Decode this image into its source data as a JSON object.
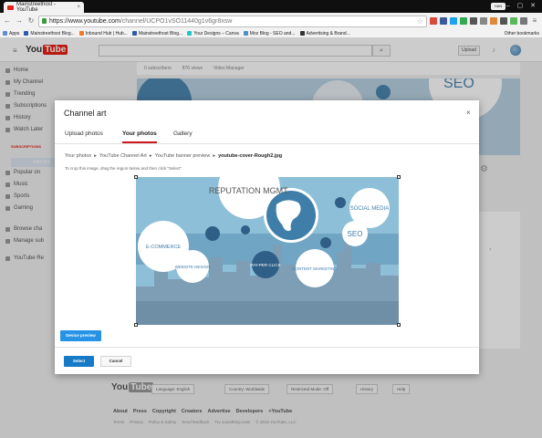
{
  "browser": {
    "tab_title": "Mainstreethost - YouTube",
    "tab_close": "×",
    "window_user": "HAN",
    "window_controls": "– ▢ ✕",
    "url_host": "https://www.youtube.com",
    "url_path": "/channel/UCPO1vSO11440g1v6gr8xsw",
    "bookmarks": [
      {
        "label": "Apps",
        "color": "#5f8dd3"
      },
      {
        "label": "Mainstreethost Blog...",
        "color": "#2d5aa8"
      },
      {
        "label": "Inbound Hub | Hub...",
        "color": "#f57722"
      },
      {
        "label": "Mainstreethost Blog...",
        "color": "#2d5aa8"
      },
      {
        "label": "Your Designs – Canva",
        "color": "#20c4cb"
      },
      {
        "label": "Moz Blog - SEO and...",
        "color": "#4a90c2"
      },
      {
        "label": "Advertising & Brand...",
        "color": "#333333"
      }
    ],
    "other_bookmarks": "Other bookmarks",
    "extensions": [
      "#d84a3a",
      "#3b5998",
      "#1da1f2",
      "#34a853",
      "#555555",
      "#888888",
      "#e0883a",
      "#555555",
      "#5cb85c",
      "#777777"
    ]
  },
  "youtube": {
    "logo_you": "You",
    "logo_tube": "Tube",
    "upload": "Upload",
    "sidebar": {
      "items": [
        "Home",
        "My Channel",
        "Trending",
        "Subscriptions",
        "History",
        "Watch Later"
      ],
      "subscriptions_heading": "SUBSCRIPTIONS",
      "add_channels": "Add cha",
      "subscriptions": [
        "Popular on",
        "Music",
        "Sports",
        "Gaming"
      ],
      "bottom_items": [
        "Browse cha",
        "Manage sub",
        "YouTube Re"
      ]
    },
    "channel_stats": {
      "subscribers": "0 subscribers",
      "views": "876 views",
      "video_manager": "Video Manager"
    },
    "footer": {
      "language": "Language: English",
      "country": "Country: Worldwide",
      "restricted": "Restricted Mode: Off",
      "history": "History",
      "help": "Help",
      "links": [
        "About",
        "Press",
        "Copyright",
        "Creators",
        "Advertise",
        "Developers",
        "+YouTube"
      ],
      "links2": [
        "Terms",
        "Privacy",
        "Policy & Safety",
        "Send feedback",
        "Try something new!",
        "© 2016 YouTube, LLC"
      ]
    }
  },
  "modal": {
    "title": "Channel art",
    "close": "×",
    "tabs": [
      "Upload photos",
      "Your photos",
      "Gallery"
    ],
    "active_tab": "Your photos",
    "breadcrumb": [
      "Your photos",
      "YouTube Channel Art",
      "YouTube banner preview",
      "youtube-cover-Rough2.jpg"
    ],
    "breadcrumb_sep": "▸",
    "hint": "To crop this image, drag the region below and then click \"Select\"",
    "image_bubbles": {
      "reputation": "REPUTATION MGMT.",
      "social": "SOCIAL MEDIA",
      "seo": "SEO",
      "ecommerce": "E-COMMERCE",
      "website": "WEBSITE DESIGN",
      "ppc": "PAY-PER CLICK",
      "content": "CONTENT MARKETING"
    },
    "device_preview": "Device preview",
    "select": "Select",
    "cancel": "Cancel"
  },
  "colors": {
    "accent_red": "#cc181e",
    "primary_blue": "#167ac6",
    "preview_blue": "#2793e6",
    "image_sky": "#7aafcb"
  }
}
